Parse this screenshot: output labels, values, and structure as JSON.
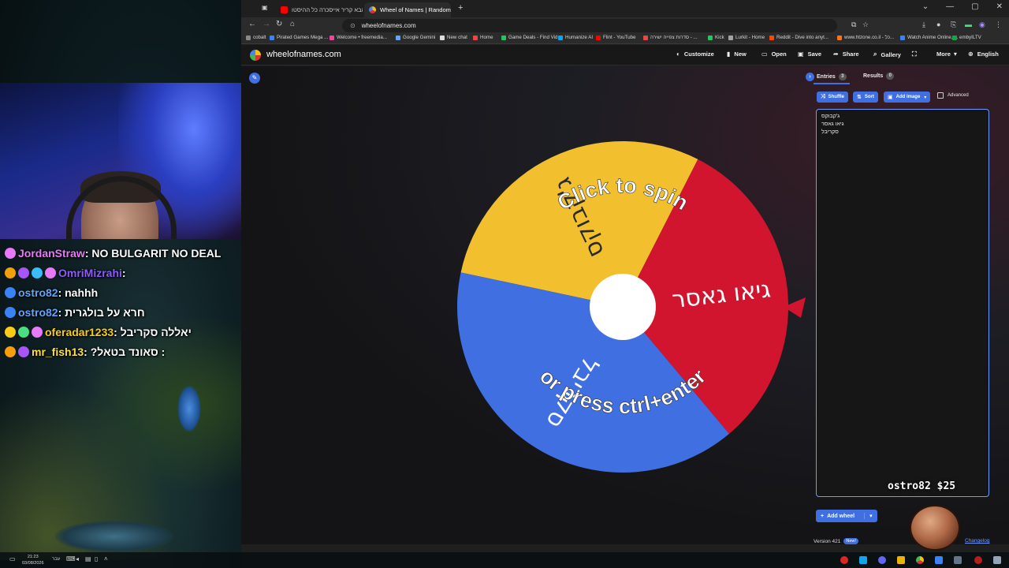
{
  "chat": [
    {
      "user": "JordanStraw",
      "user_color": "#e879f9",
      "text": ": NO BULGARIT NO DEAL",
      "badges": [
        "#e879f9"
      ]
    },
    {
      "user": "OmriMizrahi",
      "user_color": "#8b5cf6",
      "text": ":",
      "badges": [
        "#f59e0b",
        "#a855f7",
        "#38bdf8",
        "#e879f9"
      ]
    },
    {
      "user": "ostro82",
      "user_color": "#60a5fa",
      "text": ": nahhh",
      "badges": [
        "#3b82f6"
      ]
    },
    {
      "user": "ostro82",
      "user_color": "#60a5fa",
      "text": ": חרא על בולגרית",
      "badges": [
        "#3b82f6"
      ]
    },
    {
      "user": "oferadar1233",
      "user_color": "#facc15",
      "text": ": יאללה סקריבל",
      "badges": [
        "#facc15",
        "#4ade80",
        "#e879f9"
      ]
    },
    {
      "user": "mr_fish13",
      "user_color": "#fde047",
      "text": ": ?סאונד בטאל :",
      "badges": [
        "#f59e0b",
        "#a855f7"
      ]
    }
  ],
  "browser": {
    "tabs": [
      {
        "label": "אבא קריר אייסכרה כל ההיסטו",
        "favicon": "youtube-icon",
        "color": "#ff0000"
      },
      {
        "label": "Wheel of Names | Random nam",
        "favicon": "wheel-icon",
        "color": "#4885ed"
      }
    ],
    "new_tab": "+",
    "url": "wheelofnames.com",
    "bookmarks": [
      {
        "label": "cobalt",
        "color": "#888"
      },
      {
        "label": "Pirated Games Mega ...",
        "color": "#3b82f6"
      },
      {
        "label": "Welcome • freemedia...",
        "color": "#ec4899"
      },
      {
        "label": "Google Gemini",
        "color": "#60a5fa"
      },
      {
        "label": "New chat",
        "color": "#ddd"
      },
      {
        "label": "Home",
        "color": "#ef4444"
      },
      {
        "label": "Game Deals - Find Vid...",
        "color": "#22c55e"
      },
      {
        "label": "Humanize AI",
        "color": "#0ea5e9"
      },
      {
        "label": "Flint - YouTube",
        "color": "#ff0000"
      },
      {
        "label": "סדרות צפייה ישירה - ...",
        "color": "#ef4444"
      },
      {
        "label": "Kick",
        "color": "#22c55e"
      },
      {
        "label": "Lurkit - Home",
        "color": "#a3a3a3"
      },
      {
        "label": "Reddit - Dive into anyt...",
        "color": "#ff4500"
      },
      {
        "label": "www.htzone.co.il - כל...",
        "color": "#f97316"
      },
      {
        "label": "Watch Anime Online, ...",
        "color": "#3b82f6"
      },
      {
        "label": "embyILTV",
        "color": "#16a34a"
      }
    ]
  },
  "site": {
    "name": "wheelofnames.com",
    "menu": [
      {
        "label": "Customize",
        "icon": "palette-icon",
        "glyph": "◐"
      },
      {
        "label": "New",
        "icon": "new-file-icon",
        "glyph": "▮"
      },
      {
        "label": "Open",
        "icon": "folder-icon",
        "glyph": "▭"
      },
      {
        "label": "Save",
        "icon": "save-icon",
        "glyph": "▣"
      },
      {
        "label": "Share",
        "icon": "share-icon",
        "glyph": "➦"
      },
      {
        "label": "Gallery",
        "icon": "search-icon",
        "glyph": "⌕"
      },
      {
        "label": "",
        "icon": "fullscreen-icon",
        "glyph": "⛶"
      },
      {
        "label": "More",
        "icon": "chevron-down-icon",
        "glyph": "▾"
      },
      {
        "label": "English",
        "icon": "globe-icon",
        "glyph": "⊕"
      }
    ],
    "wheel": {
      "overlay_top": "Click to spin",
      "overlay_bottom": "or press ctrl+enter",
      "slices": [
        {
          "label": "ג'קבוקס",
          "color": "#f2bf2e"
        },
        {
          "label": "גיאו גאסר",
          "color": "#d2152e"
        },
        {
          "label": "סקריבל",
          "color": "#3f6fe0"
        }
      ],
      "pointer_color": "#d2152e"
    },
    "panel": {
      "tabs": [
        {
          "label": "Entries",
          "count": "3"
        },
        {
          "label": "Results",
          "count": "0"
        }
      ],
      "buttons": {
        "shuffle": "Shuffle",
        "sort": "Sort",
        "add_image": "Add image",
        "advanced": "Advanced"
      },
      "entries": [
        "ג'קבוקס",
        "גיאו גאסר",
        "סקריבל"
      ],
      "donation": "ostro82 $25",
      "add_wheel": "Add wheel",
      "version": "Version 421",
      "new_badge": "New!",
      "changelog": "Changelog"
    }
  },
  "taskbar": {
    "time": "21:23",
    "date": "03/08/2026",
    "lang": "עבר"
  }
}
